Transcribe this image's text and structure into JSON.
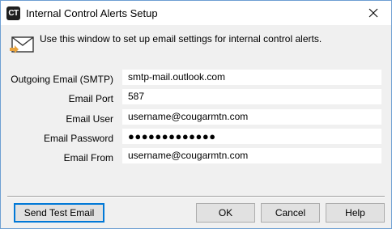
{
  "window": {
    "title": "Internal Control Alerts Setup",
    "app_icon_text": "CT"
  },
  "info": {
    "text": "Use this window to set up email settings for internal control alerts.",
    "icon": "envelope-arrow-icon"
  },
  "form": {
    "smtp_label": "Outgoing Email (SMTP)",
    "smtp_value": "smtp-mail.outlook.com",
    "port_label": "Email Port",
    "port_value": "587",
    "user_label": "Email User",
    "user_value": "username@cougarmtn.com",
    "password_label": "Email Password",
    "password_value": "●●●●●●●●●●●●●",
    "from_label": "Email From",
    "from_value": "username@cougarmtn.com"
  },
  "buttons": {
    "send_test": "Send Test Email",
    "ok": "OK",
    "cancel": "Cancel",
    "help": "Help"
  },
  "colors": {
    "window_border": "#6e9fd3",
    "dialog_bg": "#f0f0f0",
    "focus": "#0078d7",
    "envelope_arrow": "#e8a33d"
  }
}
